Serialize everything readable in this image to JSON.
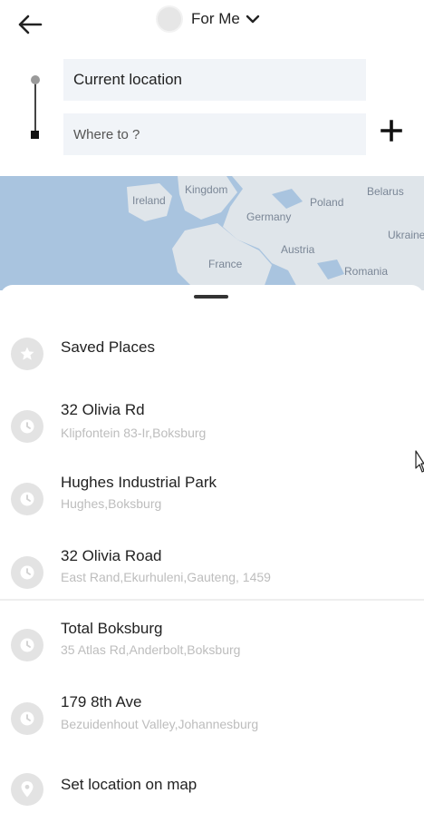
{
  "header": {
    "rider_label": "For Me",
    "current_location_placeholder": "Current location",
    "destination_placeholder": "Where to ?"
  },
  "map": {
    "labels": [
      "Ireland",
      "Kingdom",
      "Germany",
      "Poland",
      "Belarus",
      "Ukraine",
      "Austria",
      "France",
      "Romania"
    ]
  },
  "places": [
    {
      "title": "Saved Places",
      "subtitle": "",
      "icon": "star-icon"
    },
    {
      "title": "32 Olivia Rd",
      "subtitle": "Klipfontein 83-Ir,Boksburg",
      "icon": "clock-icon"
    },
    {
      "title": "Hughes Industrial Park",
      "subtitle": "Hughes,Boksburg",
      "icon": "clock-icon"
    },
    {
      "title": "32 Olivia Road",
      "subtitle": "East Rand,Ekurhuleni,Gauteng, 1459",
      "icon": "clock-icon"
    },
    {
      "title": "Total Boksburg",
      "subtitle": "35 Atlas Rd,Anderbolt,Boksburg",
      "icon": "clock-icon"
    },
    {
      "title": "179 8th Ave",
      "subtitle": "Bezuidenhout Valley,Johannesburg",
      "icon": "clock-icon"
    },
    {
      "title": "Set location on map",
      "subtitle": "",
      "icon": "map-pin-icon"
    }
  ],
  "colors": {
    "input_bg": "#f1f4f8",
    "map_water": "#a9c4df",
    "map_land": "#dfe5ea",
    "icon_bg": "#e3e3e3"
  }
}
